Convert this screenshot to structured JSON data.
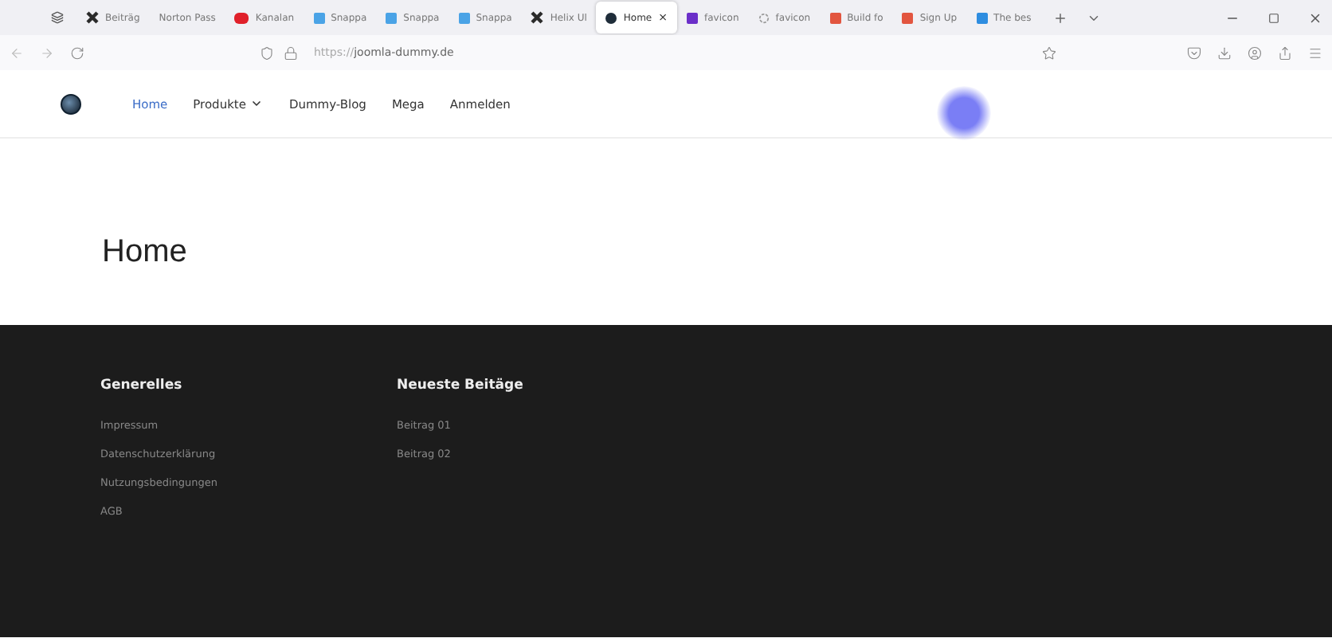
{
  "browser": {
    "tabs": [
      {
        "label": "Beiträg",
        "kind": "joomla",
        "selected": false
      },
      {
        "label": "Norton Pass",
        "kind": "plain",
        "selected": false
      },
      {
        "label": "Kanalan",
        "kind": "video",
        "color": "#e0202a",
        "selected": false
      },
      {
        "label": "Snappa",
        "kind": "square",
        "color": "#4aa3e6",
        "selected": false
      },
      {
        "label": "Snappa",
        "kind": "square",
        "color": "#4aa3e6",
        "selected": false
      },
      {
        "label": "Snappa",
        "kind": "square",
        "color": "#4aa3e6",
        "selected": false
      },
      {
        "label": "Helix Ul",
        "kind": "joomla",
        "selected": false
      },
      {
        "label": "Home",
        "kind": "dot",
        "color": "#1f2d3a",
        "selected": true
      },
      {
        "label": "favicon",
        "kind": "square",
        "color": "#6b2fc9",
        "selected": false
      },
      {
        "label": "favicon",
        "kind": "spinner",
        "selected": false
      },
      {
        "label": "Build fo",
        "kind": "square",
        "color": "#e2553f",
        "selected": false
      },
      {
        "label": "Sign Up",
        "kind": "square",
        "color": "#e2553f",
        "selected": false
      },
      {
        "label": "The bes",
        "kind": "square",
        "color": "#2e8de0",
        "selected": false
      }
    ],
    "close_mark": "×",
    "address": {
      "scheme": "https://",
      "host": "joomla-dummy.de"
    }
  },
  "nav": {
    "items": [
      {
        "label": "Home",
        "selected": true,
        "dropdown": false
      },
      {
        "label": "Produkte",
        "selected": false,
        "dropdown": true
      },
      {
        "label": "Dummy-Blog",
        "selected": false,
        "dropdown": false
      },
      {
        "label": "Mega",
        "selected": false,
        "dropdown": false
      },
      {
        "label": "Anmelden",
        "selected": false,
        "dropdown": false
      }
    ]
  },
  "page": {
    "title": "Home"
  },
  "footer": {
    "columns": [
      {
        "heading": "Generelles",
        "links": [
          "Impressum",
          "Datenschutzerklärung",
          "Nutzungsbedingungen",
          "AGB"
        ]
      },
      {
        "heading": "Neueste Beitäge",
        "links": [
          "Beitrag 01",
          "Beitrag 02"
        ]
      }
    ]
  }
}
